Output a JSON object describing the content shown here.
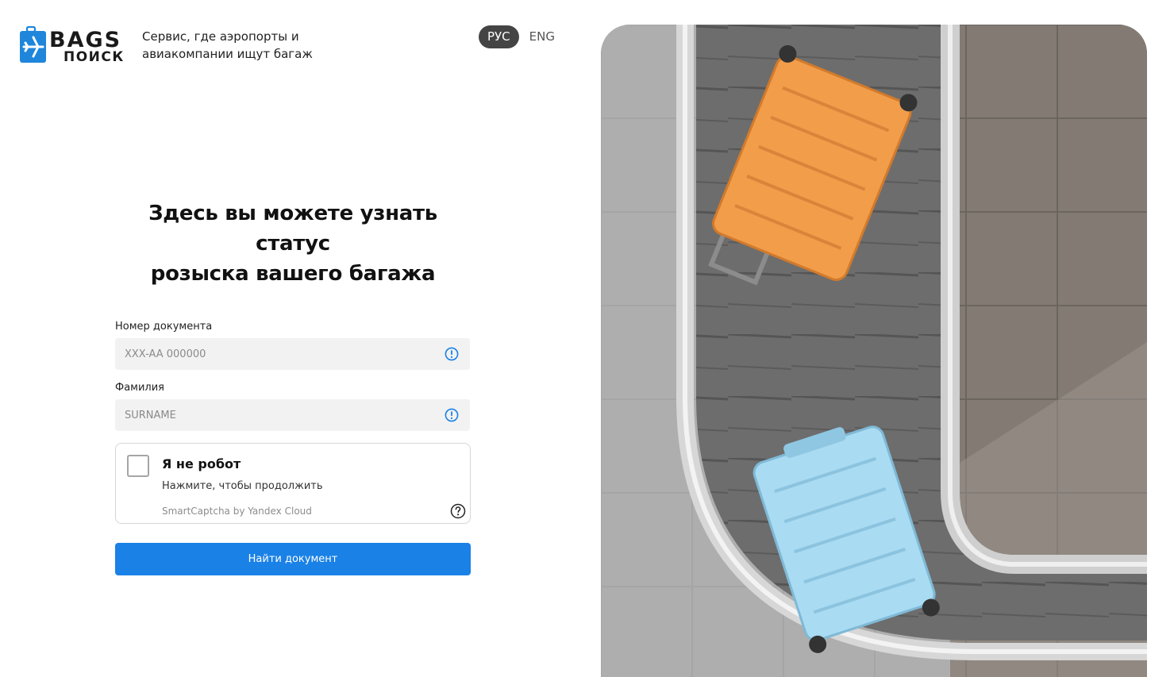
{
  "header": {
    "logo_top": "BAGS",
    "logo_bottom": "ПОИСК",
    "tagline_line1": "Сервис, где аэропорты и",
    "tagline_line2": "авиакомпании ищут багаж",
    "languages": [
      {
        "label": "РУС",
        "active": true
      },
      {
        "label": "ENG",
        "active": false
      }
    ]
  },
  "form": {
    "title_line1": "Здесь вы можете узнать статус",
    "title_line2": "розыска вашего багажа",
    "document": {
      "label": "Номер документа",
      "placeholder": "XXX-AA 000000",
      "value": ""
    },
    "surname": {
      "label": "Фамилия",
      "placeholder": "SURNAME",
      "value": ""
    },
    "captcha": {
      "title": "Я не робот",
      "subtitle": "Нажмите, чтобы продолжить",
      "brand": "SmartCaptcha by Yandex Cloud",
      "checked": false
    },
    "submit_label": "Найти документ"
  },
  "colors": {
    "accent": "#1a81e6",
    "suitcase_orange": "#f29d4a",
    "suitcase_blue": "#a9dbf2",
    "logo_blue": "#1f86dc"
  }
}
